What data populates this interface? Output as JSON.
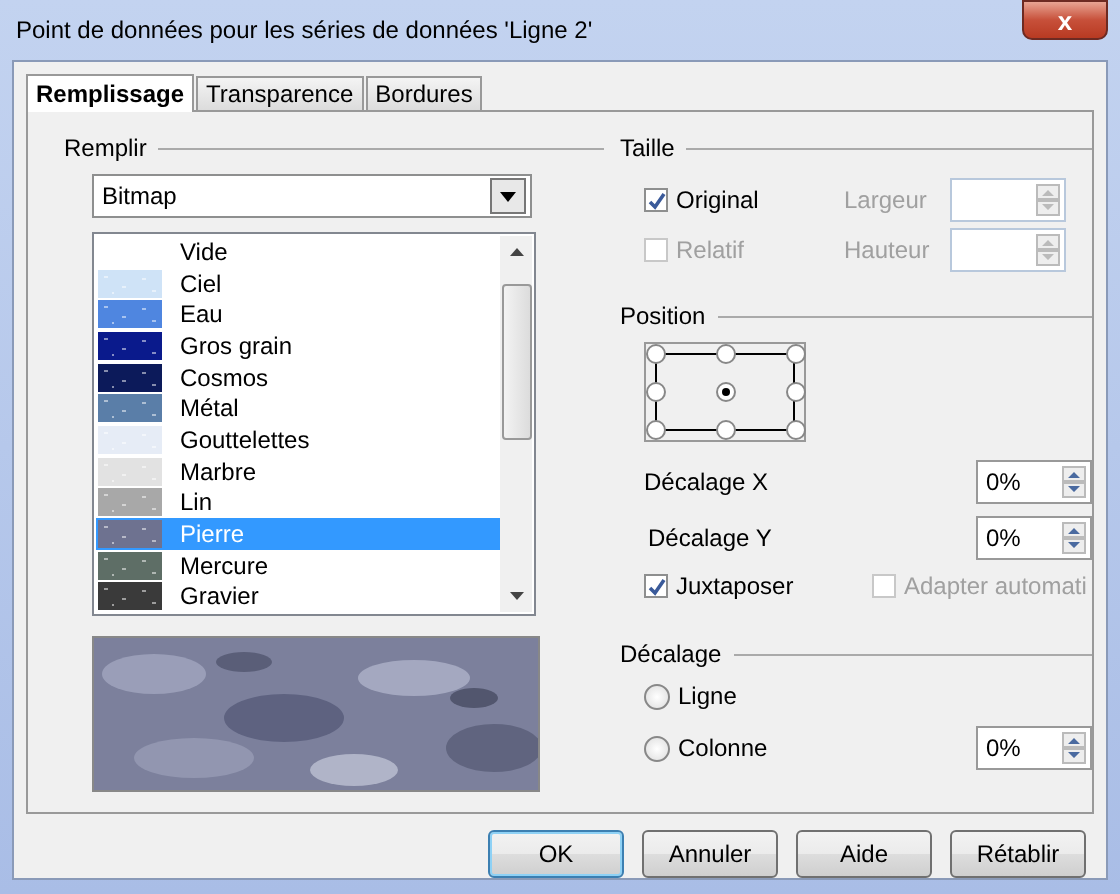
{
  "window": {
    "title": "Point de données pour les séries de données 'Ligne 2'",
    "close": "x"
  },
  "tabs": [
    {
      "label": "Remplissage",
      "selected": true
    },
    {
      "label": "Transparence",
      "selected": false
    },
    {
      "label": "Bordures",
      "selected": false
    }
  ],
  "fill": {
    "heading": "Remplir",
    "dropdown": {
      "value": "Bitmap"
    },
    "items": [
      {
        "label": "Vide",
        "selected": false
      },
      {
        "label": "Ciel",
        "color": "#cfe3f7",
        "selected": false
      },
      {
        "label": "Eau",
        "color": "#4f86e0",
        "selected": false
      },
      {
        "label": "Gros grain",
        "color": "#0a1a8c",
        "selected": false
      },
      {
        "label": "Cosmos",
        "color": "#0c1a5a",
        "selected": false
      },
      {
        "label": "Métal",
        "color": "#5a7ea8",
        "selected": false
      },
      {
        "label": "Gouttelettes",
        "color": "#e6ecf6",
        "selected": false
      },
      {
        "label": "Marbre",
        "color": "#e2e2e2",
        "selected": false
      },
      {
        "label": "Lin",
        "color": "#a8a8a8",
        "selected": false
      },
      {
        "label": "Pierre",
        "color": "#6e7290",
        "selected": true
      },
      {
        "label": "Mercure",
        "color": "#5e6e66",
        "selected": false
      },
      {
        "label": "Gravier",
        "color": "#3a3a3a",
        "selected": false
      }
    ]
  },
  "size": {
    "heading": "Taille",
    "original": {
      "label": "Original",
      "checked": true,
      "disabled": false
    },
    "relative": {
      "label": "Relatif",
      "checked": false,
      "disabled": true
    },
    "width": {
      "label": "Largeur",
      "disabled": true
    },
    "height": {
      "label": "Hauteur",
      "disabled": true
    }
  },
  "position": {
    "heading": "Position",
    "anchor_points": [
      {
        "selected": false
      },
      {
        "selected": false
      },
      {
        "selected": false
      },
      {
        "selected": false
      },
      {
        "selected": true
      },
      {
        "selected": false
      },
      {
        "selected": false
      },
      {
        "selected": false
      },
      {
        "selected": false
      }
    ],
    "offset_x": {
      "label": "Décalage X",
      "value": "0%"
    },
    "offset_y": {
      "label": "Décalage Y",
      "value": "0%"
    },
    "tile": {
      "label": "Juxtaposer",
      "checked": true,
      "disabled": false
    },
    "autofit": {
      "label": "Adapter automati",
      "checked": false,
      "disabled": true
    }
  },
  "offset": {
    "heading": "Décalage",
    "options": [
      {
        "label": "Ligne",
        "selected": false
      },
      {
        "label": "Colonne",
        "selected": false
      }
    ],
    "value": "0%"
  },
  "buttons": [
    {
      "label": "OK",
      "default": true
    },
    {
      "label": "Annuler",
      "default": false
    },
    {
      "label": "Aide",
      "default": false
    },
    {
      "label": "Rétablir",
      "default": false
    }
  ]
}
